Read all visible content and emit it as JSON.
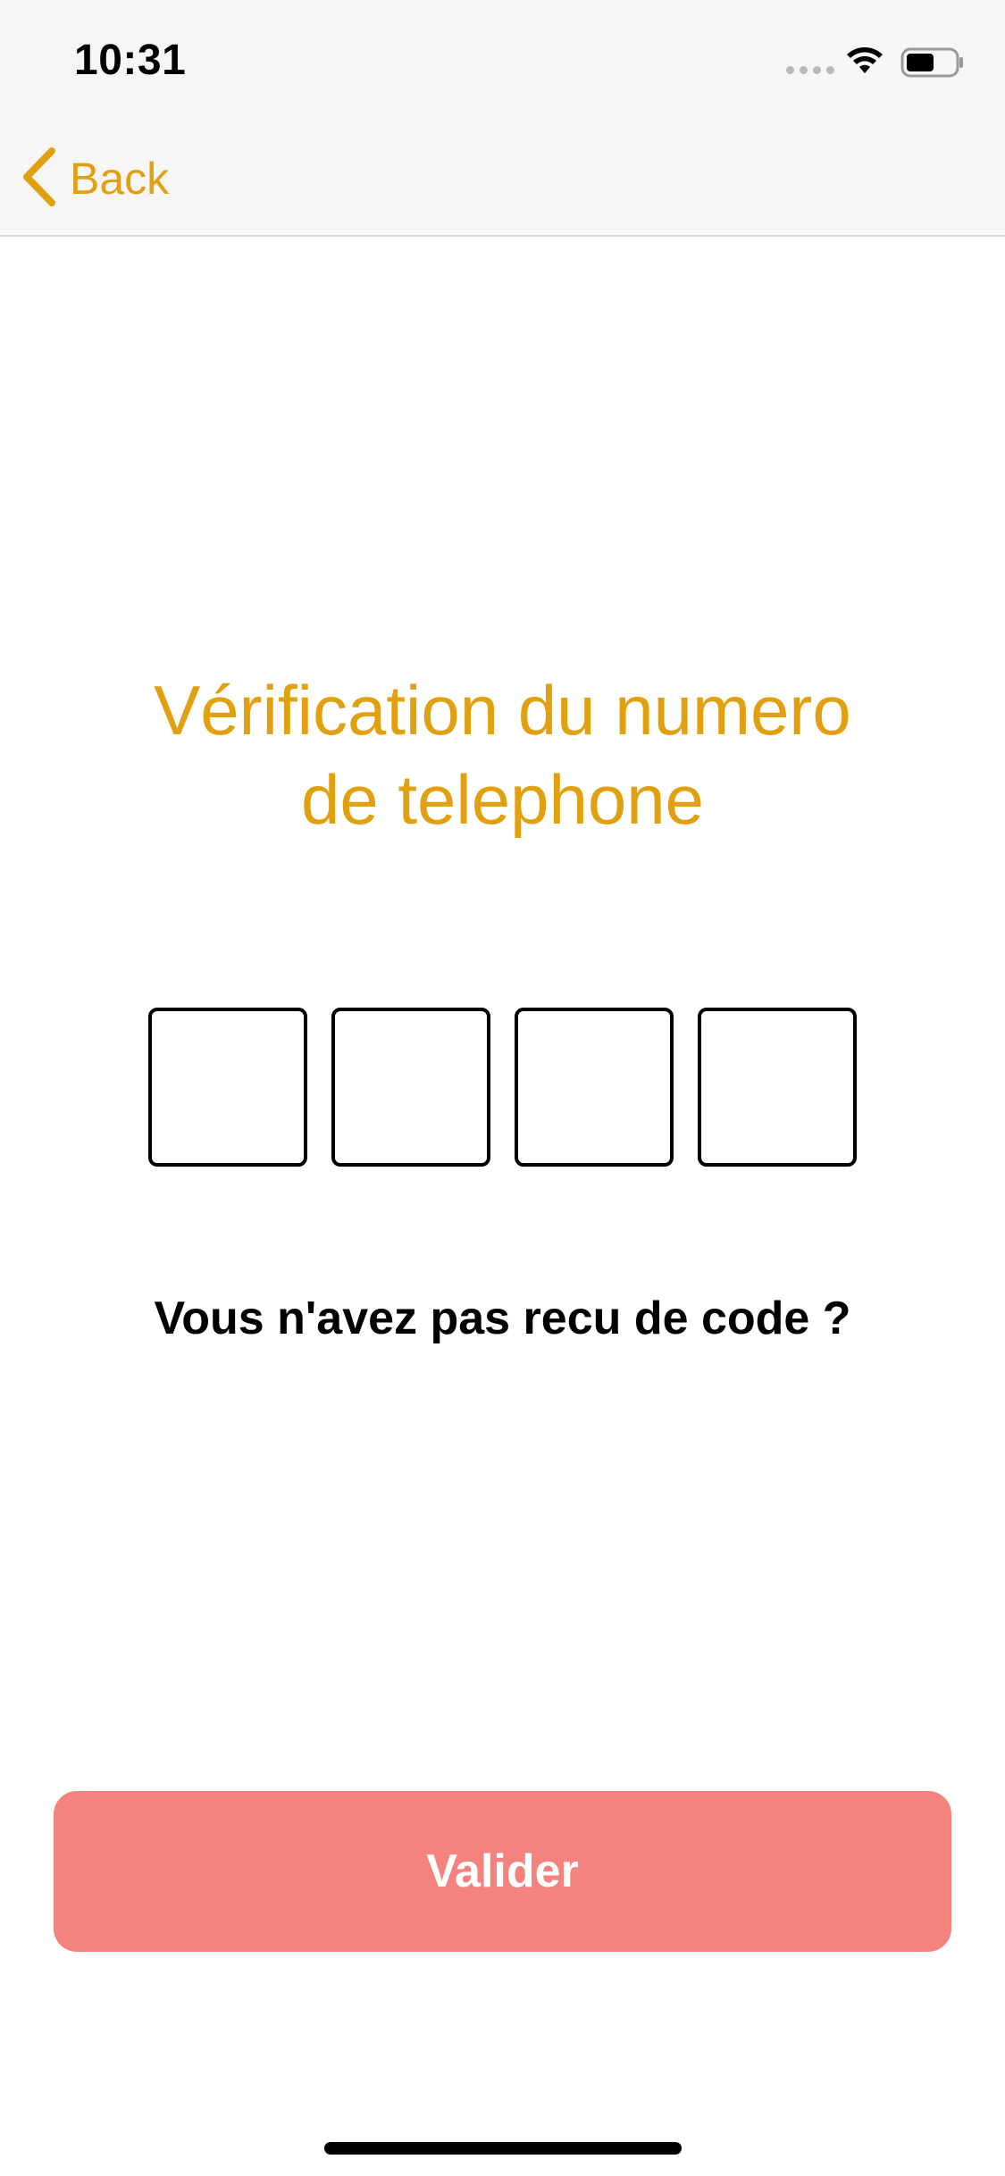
{
  "status_bar": {
    "time": "10:31",
    "icons": [
      "signal-dots-icon",
      "wifi-icon",
      "battery-icon"
    ]
  },
  "nav": {
    "back_label": "Back",
    "back_icon": "chevron-left-icon"
  },
  "main": {
    "title_line1": "Vérification du numero",
    "title_line2": "de telephone",
    "code_digits": [
      "",
      "",
      "",
      ""
    ],
    "resend_text": "Vous n'avez pas recu de code ?",
    "validate_label": "Valider"
  },
  "colors": {
    "accent": "#e0a010",
    "button": "#f4837f",
    "nav_background": "#f6f6f6"
  }
}
